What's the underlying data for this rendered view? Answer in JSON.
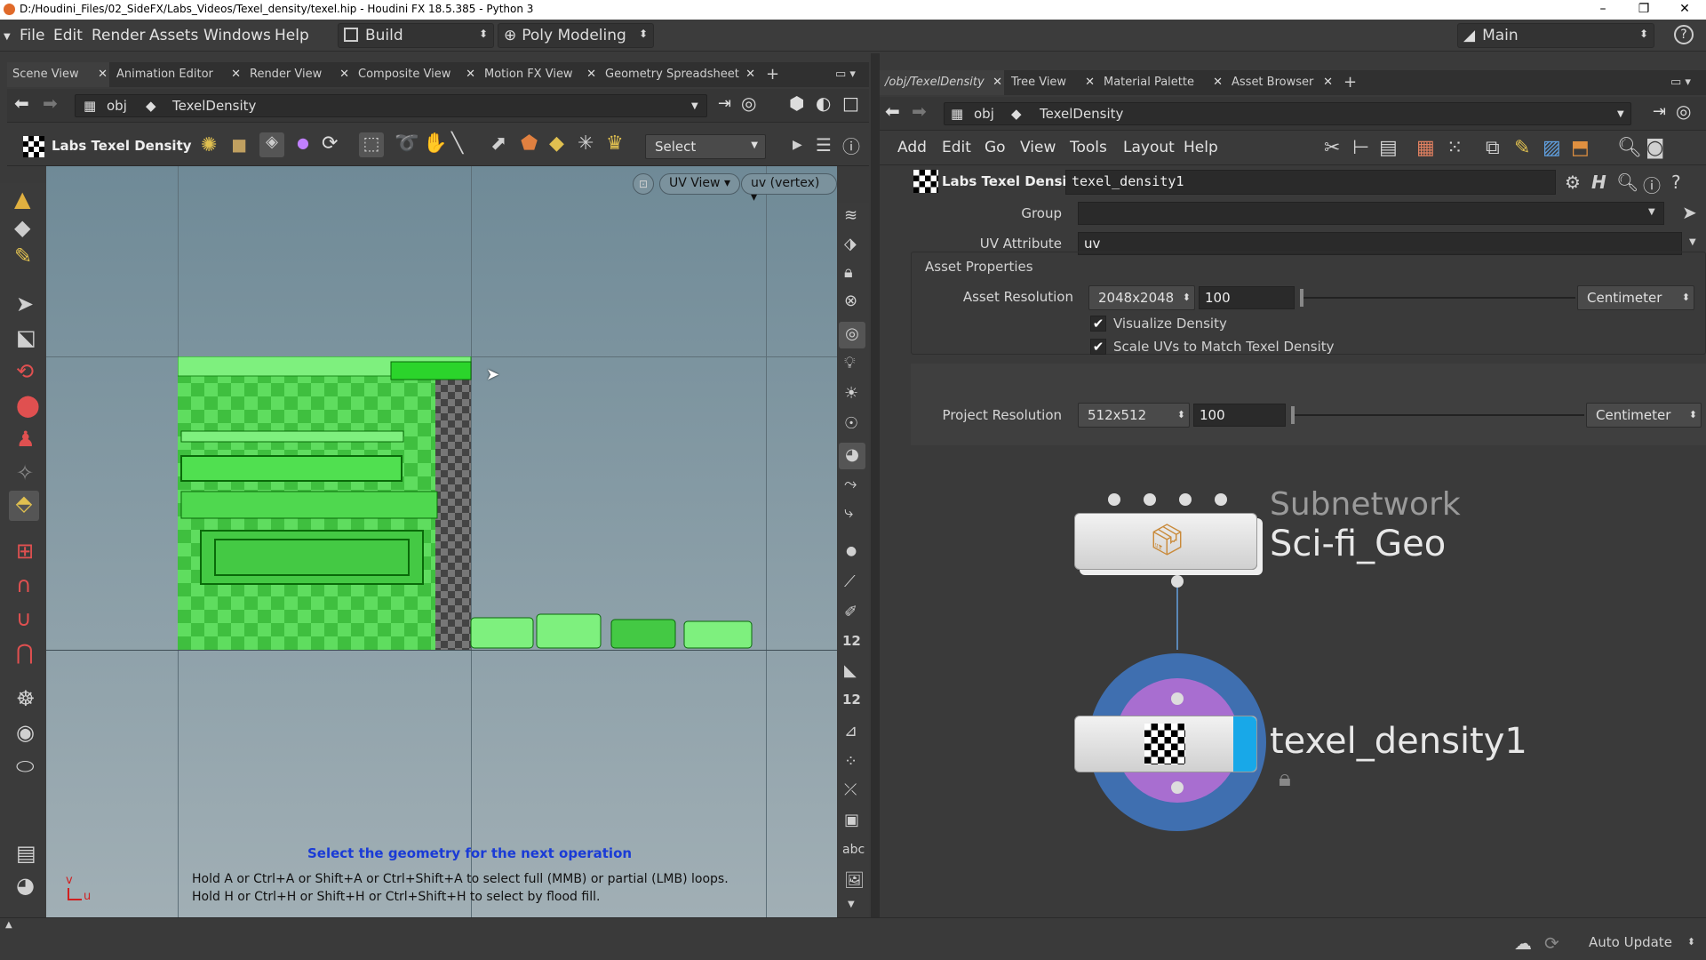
{
  "window": {
    "title": "D:/Houdini_Files/02_SideFX/Labs_Videos/Texel_density/texel.hip - Houdini FX 18.5.385 - Python 3",
    "minimize": "–",
    "maximize": "❐",
    "close": "✕"
  },
  "menubar": {
    "items": [
      "File",
      "Edit",
      "Render",
      "Assets",
      "Windows",
      "Help"
    ],
    "desktop_build": "Build",
    "desktop_poly": "Poly Modeling",
    "desktop_main": "Main"
  },
  "left_pane": {
    "tabs": [
      "Scene View",
      "Animation Editor",
      "Render View",
      "Composite View",
      "Motion FX View",
      "Geometry Spreadsheet"
    ],
    "path_root": "obj",
    "path_node": "TexelDensity",
    "tool_name": "Labs Texel Density",
    "select_mode": "Select",
    "viewport_view": "UV View",
    "viewport_attrib": "uv (vertex)",
    "status_title": "Select the geometry for the next operation",
    "hint_line1": "Hold A or Ctrl+A or Shift+A or Ctrl+Shift+A to select full (MMB) or partial (LMB) loops.",
    "hint_line2": "Hold H or Ctrl+H or Shift+H or Ctrl+Shift+H to select by flood fill.",
    "axis_v": "v",
    "axis_u": "u",
    "shelf_abc": "abc",
    "shelf_12a": "12",
    "shelf_12b": "12"
  },
  "right_pane": {
    "tabs": [
      "/obj/TexelDensity",
      "Tree View",
      "Material Palette",
      "Asset Browser"
    ],
    "path_root": "obj",
    "path_node": "TexelDensity",
    "menu": [
      "Add",
      "Edit",
      "Go",
      "View",
      "Tools",
      "Layout",
      "Help"
    ]
  },
  "params": {
    "node_type": "Labs Texel Density",
    "node_name": "texel_density1",
    "group_label": "Group",
    "group_value": "",
    "uv_attr_label": "UV Attribute",
    "uv_attr_value": "uv",
    "section": "Asset Properties",
    "asset_res_label": "Asset Resolution",
    "asset_res_value": "2048x2048",
    "asset_scale": "100",
    "asset_unit": "Centimeter",
    "visualize_label": "Visualize Density",
    "visualize_checked": true,
    "scale_uvs_label": "Scale UVs to Match Texel Density",
    "scale_uvs_checked": true,
    "project_res_label": "Project Resolution",
    "project_res_value": "512x512",
    "project_scale": "100",
    "project_unit": "Centimeter"
  },
  "network": {
    "subnet_type": "Subnetwork",
    "subnet_name": "Sci-fi_Geo",
    "node_name": "texel_density1"
  },
  "statusbar": {
    "auto_update": "Auto Update"
  }
}
